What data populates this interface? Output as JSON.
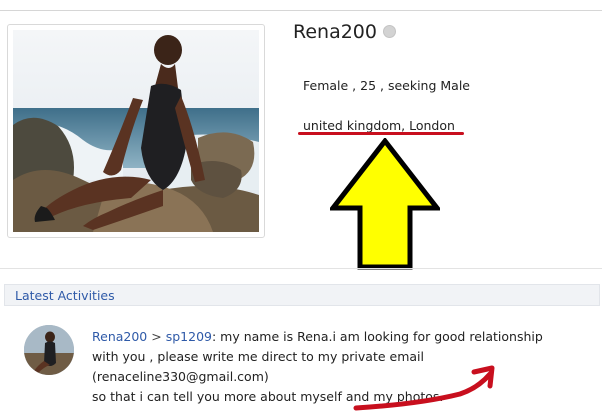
{
  "profile": {
    "username": "Rena200",
    "details": "Female , 25 , seeking Male",
    "location": "united kingdom, London"
  },
  "activities": {
    "section_title": "Latest Activities",
    "items": [
      {
        "from_user": "Rena200",
        "separator": ">",
        "to_user": "sp1209",
        "colon": ":",
        "line1": " my name is Rena.i am looking for good relationship",
        "line2": "with you , please write me direct to my private email (renaceline330@gmail.com)",
        "line3": "so that i can tell you more about  myself and my photos."
      }
    ]
  },
  "annotations": {
    "yellow_arrow_color": "#ffff00",
    "red_mark_color": "#c80f1e"
  },
  "icons": [
    "online-status-icon",
    "up-arrow-icon",
    "curved-red-arrow-icon"
  ]
}
